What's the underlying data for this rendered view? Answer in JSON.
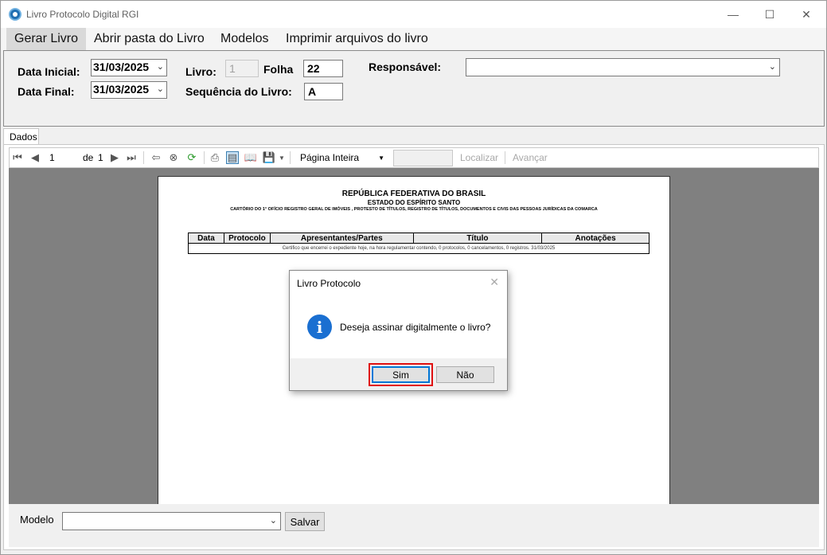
{
  "window": {
    "title": "Livro Protocolo Digital RGI"
  },
  "menu": {
    "items": [
      "Gerar Livro",
      "Abrir pasta do Livro",
      "Modelos",
      "Imprimir arquivos do livro"
    ]
  },
  "form": {
    "data_inicial_label": "Data Inicial:",
    "data_inicial_value": "31/03/2025",
    "data_final_label": "Data Final:",
    "data_final_value": "31/03/2025",
    "livro_label": "Livro:",
    "livro_value": "1",
    "folha_label": "Folha",
    "folha_value": "22",
    "sequencia_label": "Sequência do Livro:",
    "sequencia_value": "A",
    "responsavel_label": "Responsável:",
    "responsavel_value": ""
  },
  "tab": {
    "label": "Dados"
  },
  "viewer_toolbar": {
    "page_current": "1",
    "page_of": "de",
    "page_total": "1",
    "zoom_value": "Página Inteira",
    "find_label": "Localizar",
    "next_label": "Avançar"
  },
  "report": {
    "line1": "REPÚBLICA FEDERATIVA DO BRASIL",
    "line2": "ESTADO DO ESPÍRITO SANTO",
    "line3": "CARTÓRIO DO 1° OFÍCIO REGISTRO GERAL DE IMÓVEIS , PROTESTO DE TÍTULOS, REGISTRO DE TÍTULOS, DOCUMENTOS E CIVIS DAS PESSOAS JURÍDICAS DA COMARCA",
    "columns": [
      "Data",
      "Protocolo",
      "Apresentantes/Partes",
      "Título",
      "Anotações"
    ],
    "footer_row": "Certifico que encerrei o expediente hoje, na hora regulamentar contendo, 0 protocolos, 0 cancelamentos, 0 registros. 31/03/2025"
  },
  "dialog": {
    "title": "Livro Protocolo",
    "message": "Deseja assinar digitalmente o livro?",
    "yes_label": "Sim",
    "no_label": "Não"
  },
  "bottom": {
    "modelo_label": "Modelo",
    "modelo_value": "",
    "save_label": "Salvar"
  }
}
